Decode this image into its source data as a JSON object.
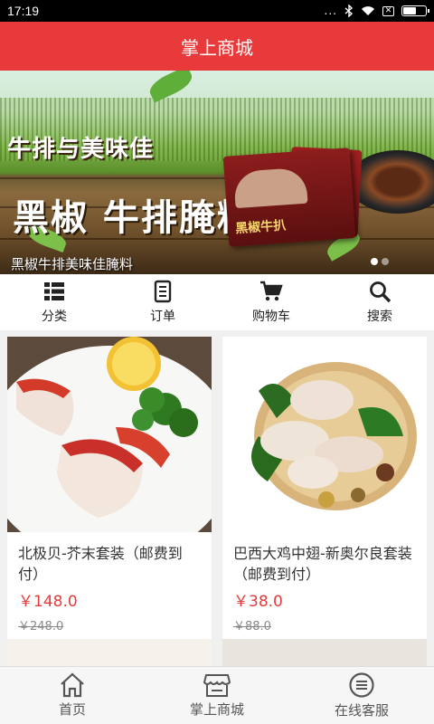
{
  "status_bar": {
    "time": "17:19",
    "dots": "...",
    "x_box": "✕"
  },
  "header": {
    "title": "掌上商城"
  },
  "banner": {
    "headline": "牛排与美味佳",
    "headline2": "黑椒 牛排腌料",
    "product_label": "黑椒牛扒",
    "caption": "黑椒牛排美味佳腌料",
    "slide_count": 2,
    "active_slide": 0
  },
  "categories": [
    {
      "label": "分类",
      "icon": "grid-list-icon"
    },
    {
      "label": "订单",
      "icon": "order-document-icon"
    },
    {
      "label": "购物车",
      "icon": "shopping-cart-icon"
    },
    {
      "label": "搜索",
      "icon": "search-icon"
    }
  ],
  "products": [
    {
      "title": "北极贝-芥末套装（邮费到付）",
      "price": "￥148.0",
      "old_price": "￥248.0"
    },
    {
      "title": "巴西大鸡中翅-新奥尔良套装（邮费到付）",
      "price": "￥38.0",
      "old_price": "￥88.0"
    }
  ],
  "tabs": [
    {
      "label": "首页",
      "icon": "home-icon"
    },
    {
      "label": "掌上商城",
      "icon": "store-icon"
    },
    {
      "label": "在线客服",
      "icon": "chat-icon"
    }
  ],
  "colors": {
    "brand_red": "#e83a3a",
    "price_red": "#e53b3b"
  }
}
